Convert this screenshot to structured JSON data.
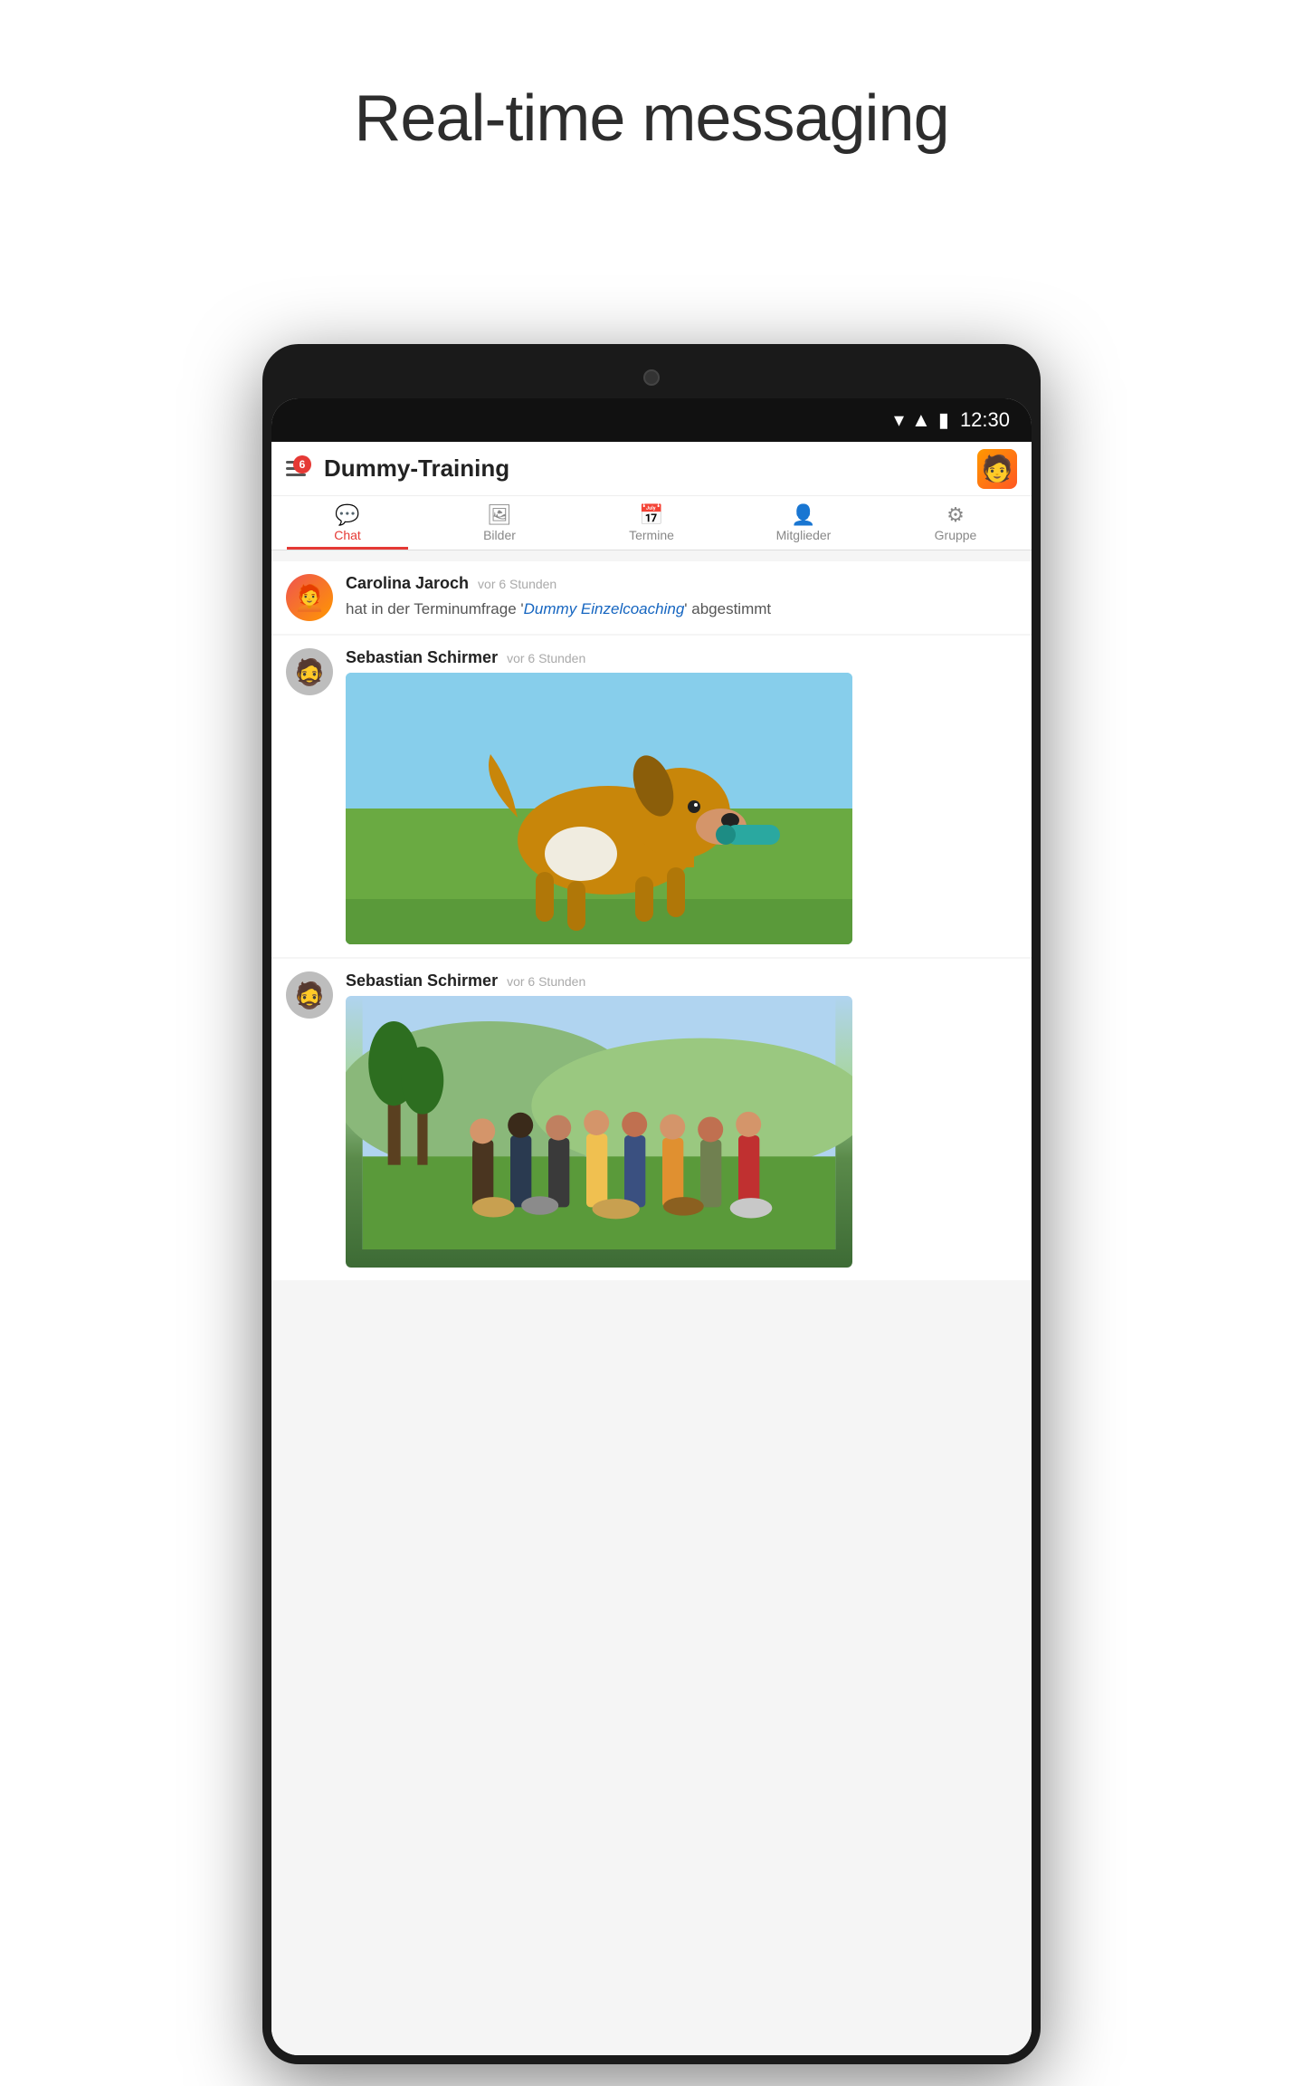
{
  "page": {
    "title": "Real-time messaging"
  },
  "status_bar": {
    "time": "12:30",
    "wifi": "▾",
    "signal": "▌",
    "battery": "▮"
  },
  "app_header": {
    "title": "Dummy-Training",
    "badge": "6"
  },
  "tabs": [
    {
      "label": "Chat",
      "icon": "💬",
      "active": true
    },
    {
      "label": "Bilder",
      "icon": "🖼",
      "active": false
    },
    {
      "label": "Termine",
      "icon": "📅",
      "active": false
    },
    {
      "label": "Mitglieder",
      "icon": "👤",
      "active": false
    },
    {
      "label": "Gruppe",
      "icon": "⚙",
      "active": false
    }
  ],
  "messages": [
    {
      "id": "msg1",
      "sender": "Carolina Jaroch",
      "time": "vor 6 Stunden",
      "text_prefix": "hat in der Terminumfrage '",
      "text_highlight": "Dummy Einzelcoaching",
      "text_suffix": "' abgestimmt",
      "has_image": false,
      "avatar_type": "carolina"
    },
    {
      "id": "msg2",
      "sender": "Sebastian Schirmer",
      "time": "vor 6 Stunden",
      "has_image": true,
      "image_type": "dog",
      "avatar_type": "sebastian"
    },
    {
      "id": "msg3",
      "sender": "Sebastian Schirmer",
      "time": "vor 6 Stunden",
      "has_image": true,
      "image_type": "group",
      "avatar_type": "sebastian"
    }
  ]
}
